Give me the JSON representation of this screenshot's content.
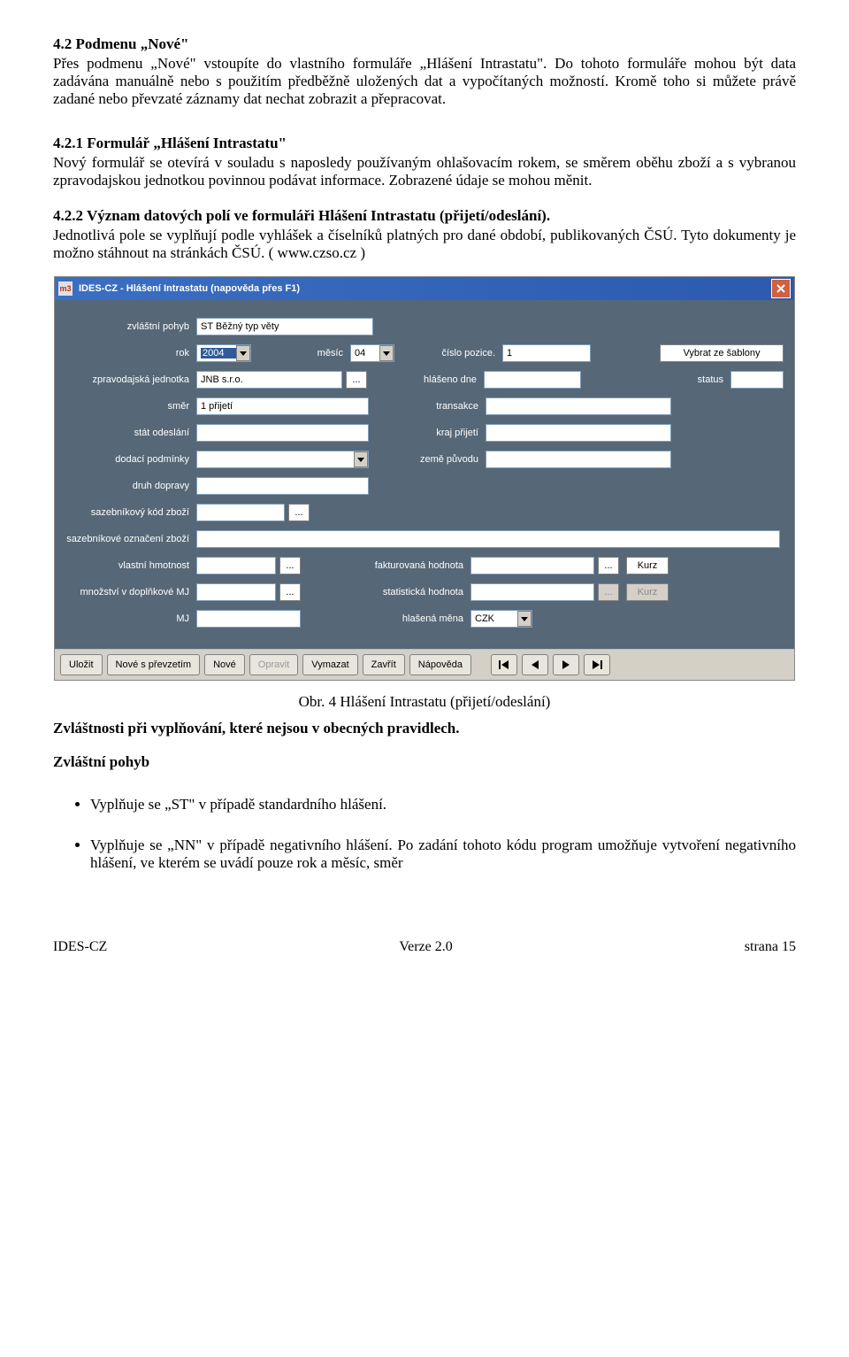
{
  "doc": {
    "h42": "4.2 Podmenu „Nové\"",
    "p42": "Přes podmenu „Nové\" vstoupíte do vlastního formuláře „Hlášení Intrastatu\". Do tohoto formuláře mohou být data zadávána manuálně nebo s použitím předběžně uložených dat a vypočítaných možností. Kromě toho si můžete právě zadané nebo převzaté záznamy dat nechat zobrazit a přepracovat.",
    "h421": "4.2.1 Formulář „Hlášení Intrastatu\"",
    "p421": "Nový formulář se otevírá v souladu s naposledy používaným ohlašovacím rokem, se směrem oběhu zboží a s vybranou zpravodajskou jednotkou povinnou podávat informace. Zobrazené údaje se mohou měnit.",
    "h422_title": "4.2.2 Význam datových polí ve formuláři Hlášení Intrastatu (přijetí/odeslání).",
    "p422": "Jednotlivá pole se vyplňují podle vyhlášek a číselníků platných pro dané období, publikovaných ČSÚ. Tyto dokumenty je možno stáhnout na stránkách ČSÚ. ( www.czso.cz )",
    "caption": "Obr. 4 Hlášení Intrastatu (přijetí/odeslání)",
    "h_special": "Zvláštnosti při vyplňování, které nejsou v obecných pravidlech.",
    "h_zvlastni": "Zvláštní pohyb",
    "bullet1": "Vyplňuje se „ST\" v případě standardního hlášení.",
    "bullet2": "Vyplňuje se „NN\" v případě negativního hlášení. Po zadání tohoto kódu program umožňuje vytvoření negativního hlášení, ve kterém se uvádí pouze rok a měsíc, směr"
  },
  "dlg": {
    "title": "IDES-CZ - Hlášení Intrastatu      (napověda přes F1)",
    "labels": {
      "zvlastni_pohyb": "zvláštní pohyb",
      "rok": "rok",
      "mesic": "měsíc",
      "cislo_pozice": "číslo pozice.",
      "zpravodajska_jednotka": "zpravodajská jednotka",
      "hlaseno_dne": "hlášeno dne",
      "status": "status",
      "smer": "směr",
      "transakce": "transakce",
      "stat_odeslani": "stát odeslání",
      "kraj_prijeti": "kraj přijetí",
      "dodaci_podminky": "dodací podmínky",
      "zeme_puvodu": "země původu",
      "druh_dopravy": "druh dopravy",
      "sazebnikovy_kod": "sazebníkový kód zboží",
      "sazebnikove_oznaceni": "sazebníkové označení zboží",
      "vlastni_hmotnost": "vlastní hmotnost",
      "fakturovana_hodnota": "fakturovaná hodnota",
      "mnozstvi_mj": "množství v doplňkové MJ",
      "statisticka_hodnota": "statistická hodnota",
      "mj": "MJ",
      "hlasena_mena": "hlašená měna"
    },
    "values": {
      "zvlastni_pohyb": "ST Běžný typ věty",
      "rok": "2004",
      "mesic": "04",
      "pozice": "1",
      "jednotka": "JNB s.r.o.",
      "smer": "1 přijetí",
      "mena": "CZK"
    },
    "buttons": {
      "vybrat_sablonu": "Vybrat ze šablony",
      "kurz": "Kurz",
      "ulozit": "Uložit",
      "nove_prevzetim": "Nové s převzetím",
      "nove": "Nové",
      "opravit": "Opravit",
      "vymazat": "Vymazat",
      "zavrit": "Zavřít",
      "napoveda": "Nápověda",
      "ellipsis": "..."
    }
  },
  "footer": {
    "left": "IDES-CZ",
    "center": "Verze 2.0",
    "right": "strana 15"
  }
}
